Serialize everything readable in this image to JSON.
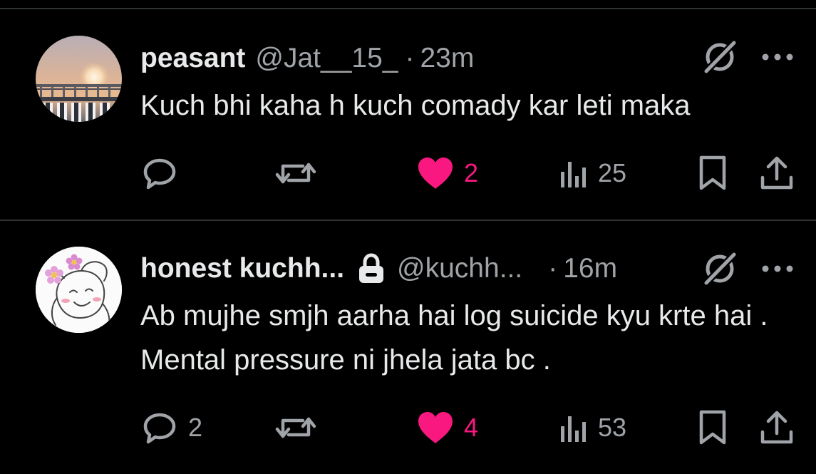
{
  "colors": {
    "background": "#000000",
    "text": "#e7e9ea",
    "secondary": "#a0a4a8",
    "like": "#f91880",
    "divider": "#2f3336"
  },
  "posts": [
    {
      "display_name": "peasant",
      "handle": "@Jat__15_",
      "separator": "·",
      "time": "23m",
      "text": "Kuch bhi kaha h kuch comady kar leti maka",
      "avatar_icon": "sunset-bridge-photo",
      "protected": false,
      "reply_count": "",
      "repost_count": "",
      "like_count": "2",
      "liked": true,
      "view_count": "25"
    },
    {
      "display_name": "honest kuchh...",
      "handle": "@kuchh...",
      "separator": "·",
      "time": "16m",
      "text": "Ab mujhe smjh aarha hai log suicide kyu krte hai . Mental pressure ni jhela jata bc .",
      "avatar_icon": "doodle-face-with-flowers",
      "protected": true,
      "reply_count": "2",
      "repost_count": "",
      "like_count": "4",
      "liked": true,
      "view_count": "53"
    }
  ],
  "icons": {
    "reply": "reply-icon",
    "repost": "repost-icon",
    "like": "heart-icon",
    "views": "views-icon",
    "bookmark": "bookmark-icon",
    "share": "share-icon",
    "grok": "grok-icon",
    "more": "more-icon",
    "lock": "lock-icon"
  }
}
